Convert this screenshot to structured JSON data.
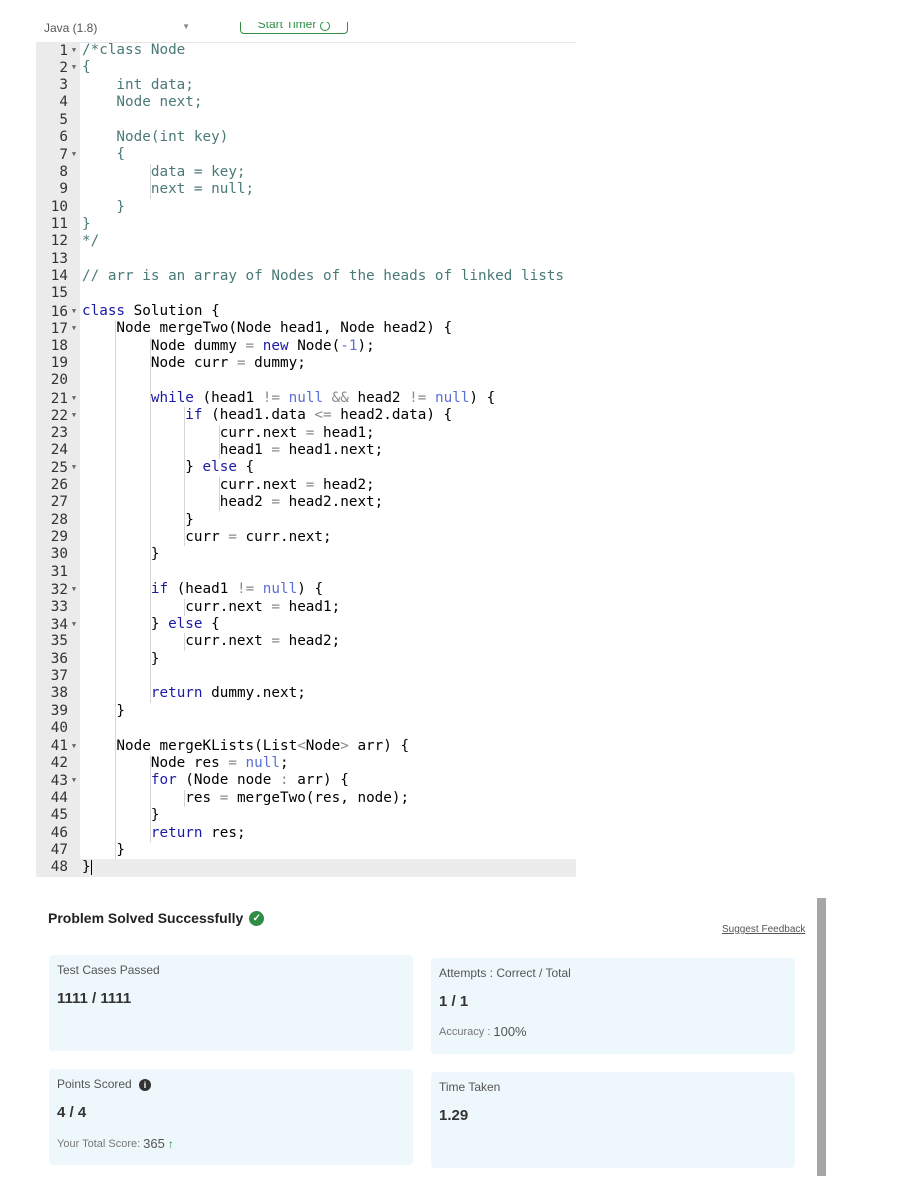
{
  "editor": {
    "language": "Java (1.8)",
    "start_timer_label": "Start Timer",
    "lines": [
      [
        [
          "cm",
          "/*class Node"
        ]
      ],
      [
        [
          "cm",
          "{"
        ]
      ],
      [
        [
          "cm",
          "    int data;"
        ]
      ],
      [
        [
          "cm",
          "    Node next;"
        ]
      ],
      [],
      [
        [
          "cm",
          "    Node(int key)"
        ]
      ],
      [
        [
          "cm",
          "    {"
        ]
      ],
      [
        [
          "cm",
          "        data = key;"
        ]
      ],
      [
        [
          "cm",
          "        next = null;"
        ]
      ],
      [
        [
          "cm",
          "    }"
        ]
      ],
      [
        [
          "cm",
          "}"
        ]
      ],
      [
        [
          "cm",
          "*/"
        ]
      ],
      [],
      [
        [
          "cm",
          "// arr is an array of Nodes of the heads of linked lists"
        ]
      ],
      [],
      [
        [
          "kw",
          "class"
        ],
        [
          "tx",
          " Solution {"
        ]
      ],
      [
        [
          "tx",
          "    Node mergeTwo(Node head1, Node head2) {"
        ]
      ],
      [
        [
          "tx",
          "        Node dummy "
        ],
        [
          "op",
          "="
        ],
        [
          "tx",
          " "
        ],
        [
          "kw",
          "new"
        ],
        [
          "tx",
          " Node("
        ],
        [
          "lit",
          "-1"
        ],
        [
          "tx",
          ");"
        ]
      ],
      [
        [
          "tx",
          "        Node curr "
        ],
        [
          "op",
          "="
        ],
        [
          "tx",
          " dummy;"
        ]
      ],
      [],
      [
        [
          "tx",
          "        "
        ],
        [
          "kw",
          "while"
        ],
        [
          "tx",
          " (head1 "
        ],
        [
          "op",
          "!="
        ],
        [
          "tx",
          " "
        ],
        [
          "lit",
          "null"
        ],
        [
          "tx",
          " "
        ],
        [
          "op",
          "&&"
        ],
        [
          "tx",
          " head2 "
        ],
        [
          "op",
          "!="
        ],
        [
          "tx",
          " "
        ],
        [
          "lit",
          "null"
        ],
        [
          "tx",
          ") {"
        ]
      ],
      [
        [
          "tx",
          "            "
        ],
        [
          "kw",
          "if"
        ],
        [
          "tx",
          " (head1.data "
        ],
        [
          "op",
          "<="
        ],
        [
          "tx",
          " head2.data) {"
        ]
      ],
      [
        [
          "tx",
          "                curr.next "
        ],
        [
          "op",
          "="
        ],
        [
          "tx",
          " head1;"
        ]
      ],
      [
        [
          "tx",
          "                head1 "
        ],
        [
          "op",
          "="
        ],
        [
          "tx",
          " head1.next;"
        ]
      ],
      [
        [
          "tx",
          "            } "
        ],
        [
          "kw",
          "else"
        ],
        [
          "tx",
          " {"
        ]
      ],
      [
        [
          "tx",
          "                curr.next "
        ],
        [
          "op",
          "="
        ],
        [
          "tx",
          " head2;"
        ]
      ],
      [
        [
          "tx",
          "                head2 "
        ],
        [
          "op",
          "="
        ],
        [
          "tx",
          " head2.next;"
        ]
      ],
      [
        [
          "tx",
          "            }"
        ]
      ],
      [
        [
          "tx",
          "            curr "
        ],
        [
          "op",
          "="
        ],
        [
          "tx",
          " curr.next;"
        ]
      ],
      [
        [
          "tx",
          "        }"
        ]
      ],
      [],
      [
        [
          "tx",
          "        "
        ],
        [
          "kw",
          "if"
        ],
        [
          "tx",
          " (head1 "
        ],
        [
          "op",
          "!="
        ],
        [
          "tx",
          " "
        ],
        [
          "lit",
          "null"
        ],
        [
          "tx",
          ") {"
        ]
      ],
      [
        [
          "tx",
          "            curr.next "
        ],
        [
          "op",
          "="
        ],
        [
          "tx",
          " head1;"
        ]
      ],
      [
        [
          "tx",
          "        } "
        ],
        [
          "kw",
          "else"
        ],
        [
          "tx",
          " {"
        ]
      ],
      [
        [
          "tx",
          "            curr.next "
        ],
        [
          "op",
          "="
        ],
        [
          "tx",
          " head2;"
        ]
      ],
      [
        [
          "tx",
          "        }"
        ]
      ],
      [],
      [
        [
          "tx",
          "        "
        ],
        [
          "kw",
          "return"
        ],
        [
          "tx",
          " dummy.next;"
        ]
      ],
      [
        [
          "tx",
          "    }"
        ]
      ],
      [],
      [
        [
          "tx",
          "    Node mergeKLists(List"
        ],
        [
          "op",
          "<"
        ],
        [
          "tx",
          "Node"
        ],
        [
          "op",
          ">"
        ],
        [
          "tx",
          " arr) {"
        ]
      ],
      [
        [
          "tx",
          "        Node res "
        ],
        [
          "op",
          "="
        ],
        [
          "tx",
          " "
        ],
        [
          "lit",
          "null"
        ],
        [
          "tx",
          ";"
        ]
      ],
      [
        [
          "tx",
          "        "
        ],
        [
          "kw",
          "for"
        ],
        [
          "tx",
          " (Node node "
        ],
        [
          "op",
          ":"
        ],
        [
          "tx",
          " arr) {"
        ]
      ],
      [
        [
          "tx",
          "            res "
        ],
        [
          "op",
          "="
        ],
        [
          "tx",
          " mergeTwo(res, node);"
        ]
      ],
      [
        [
          "tx",
          "        }"
        ]
      ],
      [
        [
          "tx",
          "        "
        ],
        [
          "kw",
          "return"
        ],
        [
          "tx",
          " res;"
        ]
      ],
      [
        [
          "tx",
          "    }"
        ]
      ],
      [
        [
          "tx",
          "}"
        ]
      ]
    ]
  },
  "result": {
    "title": "Problem Solved Successfully",
    "suggest_feedback": "Suggest Feedback",
    "test_cases": {
      "label": "Test Cases Passed",
      "value": "1111 / 1111"
    },
    "attempts": {
      "label": "Attempts : Correct / Total",
      "value": "1 / 1",
      "accuracy_label": "Accuracy :",
      "accuracy_value": "100%"
    },
    "points": {
      "label": "Points Scored",
      "value": "4 / 4",
      "total_label": "Your Total Score:",
      "total_value": "365"
    },
    "time": {
      "label": "Time Taken",
      "value": "1.29"
    }
  },
  "colors": {
    "accent_green": "#2f8d46",
    "card_bg": "#eef8fc"
  },
  "icons": {
    "success": "check-circle-icon",
    "info": "info-icon",
    "trend": "up-arrow-icon",
    "timer": "clock-icon"
  }
}
